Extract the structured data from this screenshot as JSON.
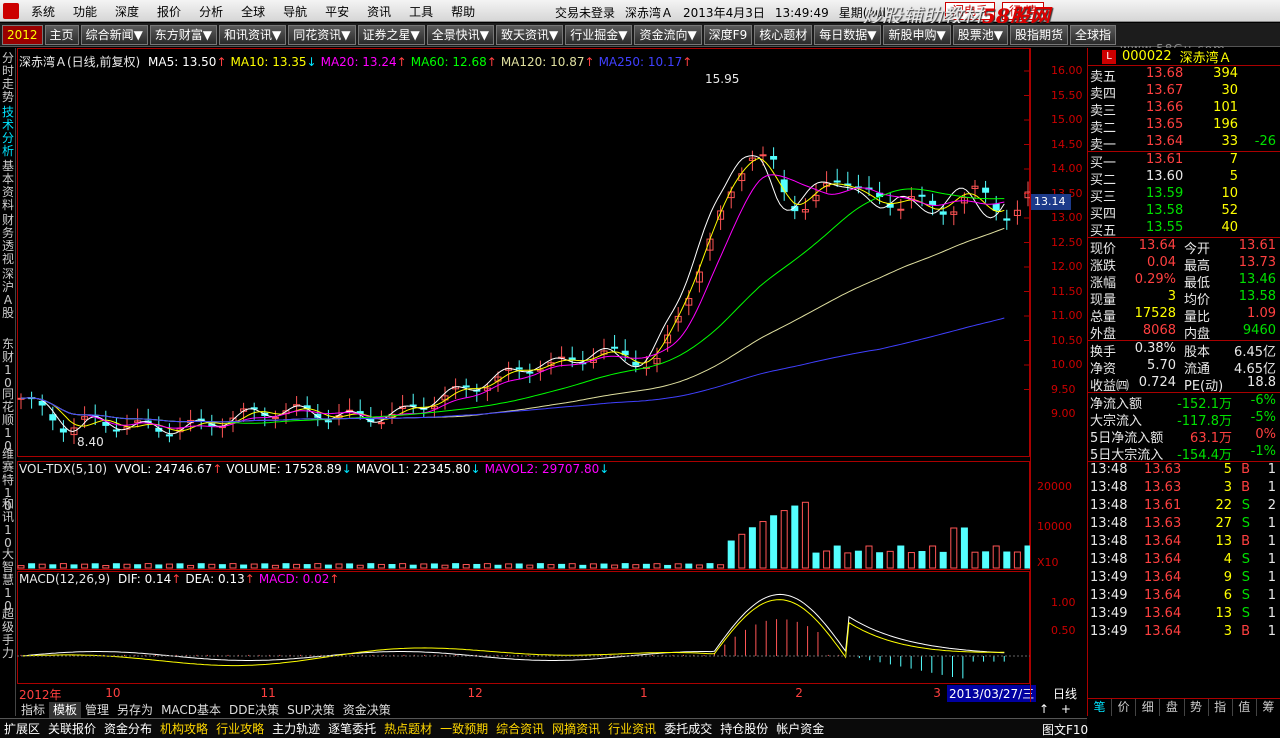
{
  "menubar": {
    "items": [
      "系统",
      "功能",
      "深度",
      "报价",
      "分析",
      "全球",
      "导航",
      "平安",
      "资讯",
      "工具",
      "帮助"
    ],
    "status": [
      "交易未登录",
      "深赤湾Ａ",
      "2013年4月3日",
      "13:49:49",
      "星期(null)"
    ],
    "btn_flash": "闪电手",
    "btn_quote": "行 情",
    "brand_a": "炒股辅助教材",
    "brand_b": "58股网"
  },
  "toolbar": {
    "logo": "2012",
    "items": [
      "主页",
      "综合新闻▼",
      "东方财富▼",
      "和讯资讯▼",
      "同花资讯▼",
      "证券之星▼",
      "全景快讯▼",
      "致天资讯▼",
      "行业掘金▼",
      "资金流向▼",
      "深度F9",
      "核心题材",
      "每日数据▼",
      "新股申购▼",
      "股票池▼",
      "股指期货",
      "全球指"
    ],
    "watermark": "www.58Gu.com"
  },
  "left_tabs": [
    "分时走势",
    "技术分析",
    "基本资料",
    "财务透视",
    "深沪A股",
    "东财10",
    "同花顺10",
    "维赛特10",
    "和讯10",
    "大智慧10",
    "超级手力"
  ],
  "main": {
    "stock_title": "深赤湾Ａ(日线,前复权)",
    "ma": [
      {
        "label": "MA5: 13.50",
        "arrow": "↑",
        "color": "#ffffff"
      },
      {
        "label": "MA10: 13.35",
        "arrow": "↓",
        "color": "#ffff00"
      },
      {
        "label": "MA20: 13.24",
        "arrow": "↑",
        "color": "#ff00ff"
      },
      {
        "label": "MA60: 12.68",
        "arrow": "↑",
        "color": "#00ff00"
      },
      {
        "label": "MA120: 10.87",
        "arrow": "↑",
        "color": "#e0e0a0"
      },
      {
        "label": "MA250: 10.17",
        "arrow": "↑",
        "color": "#4040ff"
      }
    ],
    "high_label": "15.95",
    "low_label": "8.40",
    "vol": {
      "title": "VOL-TDX(5,10)",
      "items": [
        {
          "label": "VVOL: 24746.67",
          "arrow": "↑",
          "color": "#ffffff"
        },
        {
          "label": "VOLUME: 17528.89",
          "arrow": "↓",
          "color": "#ffffff"
        },
        {
          "label": "MAVOL1: 22345.80",
          "arrow": "↓",
          "color": "#ffffff"
        },
        {
          "label": "MAVOL2: 29707.80",
          "arrow": "↓",
          "color": "#ff00ff"
        }
      ]
    },
    "macd": {
      "title": "MACD(12,26,9)",
      "items": [
        {
          "label": "DIF: 0.14",
          "arrow": "↑",
          "color": "#ffffff"
        },
        {
          "label": "DEA: 0.13",
          "arrow": "↑",
          "color": "#ffffff"
        },
        {
          "label": "MACD: 0.02",
          "arrow": "↑",
          "color": "#ff00ff"
        }
      ]
    },
    "date_box": "2013/03/27/三",
    "x_ticks": [
      {
        "t": "2012年",
        "i": 0
      },
      {
        "t": "10",
        "i": 25
      },
      {
        "t": "11",
        "i": 70
      },
      {
        "t": "12",
        "i": 130
      },
      {
        "t": "1",
        "i": 180
      },
      {
        "t": "2",
        "i": 225
      },
      {
        "t": "3",
        "i": 265
      }
    ]
  },
  "axis": {
    "price_ticks": [
      "16.00",
      "15.50",
      "15.00",
      "14.50",
      "14.00",
      "13.50",
      "13.00",
      "12.50",
      "12.00",
      "11.50",
      "11.00",
      "10.50",
      "10.00",
      "9.50",
      "9.00"
    ],
    "current_price": "13.14",
    "vol_ticks": [
      "20000",
      "10000"
    ],
    "vol_unit": "X10",
    "macd_ticks": [
      "1.00",
      "0.50"
    ]
  },
  "panel": {
    "license": "L",
    "code": "000022",
    "name": "深赤湾Ａ",
    "sell": [
      {
        "l": "卖五",
        "p": "13.68",
        "v": "394",
        "d": ""
      },
      {
        "l": "卖四",
        "p": "13.67",
        "v": "30",
        "d": ""
      },
      {
        "l": "卖三",
        "p": "13.66",
        "v": "101",
        "d": ""
      },
      {
        "l": "卖二",
        "p": "13.65",
        "v": "196",
        "d": ""
      },
      {
        "l": "卖一",
        "p": "13.64",
        "v": "33",
        "d": "-26"
      }
    ],
    "buy": [
      {
        "l": "买一",
        "p": "13.61",
        "v": "7",
        "c": "red"
      },
      {
        "l": "买二",
        "p": "13.60",
        "v": "5",
        "c": "white"
      },
      {
        "l": "买三",
        "p": "13.59",
        "v": "10",
        "c": "green"
      },
      {
        "l": "买四",
        "p": "13.58",
        "v": "52",
        "c": "green"
      },
      {
        "l": "买五",
        "p": "13.55",
        "v": "40",
        "c": "green"
      }
    ],
    "stats": [
      {
        "l1": "现价",
        "v1": "13.64",
        "c1": "red",
        "l2": "今开",
        "v2": "13.61",
        "c2": "red"
      },
      {
        "l1": "涨跌",
        "v1": "0.04",
        "c1": "red",
        "l2": "最高",
        "v2": "13.73",
        "c2": "red"
      },
      {
        "l1": "涨幅",
        "v1": "0.29%",
        "c1": "red",
        "l2": "最低",
        "v2": "13.46",
        "c2": "green"
      },
      {
        "l1": "现量",
        "v1": "3",
        "c1": "yellow",
        "l2": "均价",
        "v2": "13.58",
        "c2": "green"
      },
      {
        "l1": "总量",
        "v1": "17528",
        "c1": "yellow",
        "l2": "量比",
        "v2": "1.09",
        "c2": "red"
      },
      {
        "l1": "外盘",
        "v1": "8068",
        "c1": "red",
        "l2": "内盘",
        "v2": "9460",
        "c2": "green"
      }
    ],
    "stats2": [
      {
        "l1": "换手",
        "v1": "0.38%",
        "c1": "white",
        "l2": "股本",
        "v2": "6.45亿",
        "c2": "white"
      },
      {
        "l1": "净资",
        "v1": "5.70",
        "c1": "white",
        "l2": "流通",
        "v2": "4.65亿",
        "c2": "white"
      },
      {
        "l1": "收益㈣",
        "v1": "0.724",
        "c1": "white",
        "l2": "PE(动)",
        "v2": "18.8",
        "c2": "white"
      }
    ],
    "flows": [
      {
        "l": "净流入额",
        "v": "-152.1万",
        "p": "-6%",
        "c": "green"
      },
      {
        "l": "大宗流入",
        "v": "-117.8万",
        "p": "-5%",
        "c": "green"
      },
      {
        "l": "5日净流入额",
        "v": "63.1万",
        "p": "0%",
        "c": "red"
      },
      {
        "l": "5日大宗流入",
        "v": "-154.4万",
        "p": "-1%",
        "c": "green"
      }
    ],
    "ticks": [
      {
        "t": "13:48",
        "p": "13.63",
        "v": "5",
        "s": "B",
        "n": "1"
      },
      {
        "t": "13:48",
        "p": "13.63",
        "v": "3",
        "s": "B",
        "n": "1"
      },
      {
        "t": "13:48",
        "p": "13.61",
        "v": "22",
        "s": "S",
        "n": "2"
      },
      {
        "t": "13:48",
        "p": "13.63",
        "v": "27",
        "s": "S",
        "n": "1"
      },
      {
        "t": "13:48",
        "p": "13.64",
        "v": "13",
        "s": "B",
        "n": "1"
      },
      {
        "t": "13:48",
        "p": "13.64",
        "v": "4",
        "s": "S",
        "n": "1"
      },
      {
        "t": "13:49",
        "p": "13.64",
        "v": "9",
        "s": "S",
        "n": "1"
      },
      {
        "t": "13:49",
        "p": "13.64",
        "v": "6",
        "s": "S",
        "n": "1"
      },
      {
        "t": "13:49",
        "p": "13.64",
        "v": "13",
        "s": "S",
        "n": "1"
      },
      {
        "t": "13:49",
        "p": "13.64",
        "v": "3",
        "s": "B",
        "n": "1"
      }
    ],
    "tabs": [
      "笔",
      "价",
      "细",
      "盘",
      "势",
      "指",
      "值",
      "筹"
    ]
  },
  "bottom": {
    "period": "日线",
    "ctrl": "↑ + - ↓",
    "tabs1": [
      "指标",
      "模板",
      "管理",
      "另存为",
      "MACD基本",
      "DDE决策",
      "SUP决策",
      "资金决策"
    ],
    "tabs2": [
      {
        "t": "扩展区",
        "hl": false
      },
      {
        "t": "关联报价",
        "hl": false
      },
      {
        "t": "资金分布",
        "hl": false
      },
      {
        "t": "机构攻略",
        "hl": true
      },
      {
        "t": "行业攻略",
        "hl": true
      },
      {
        "t": "主力轨迹",
        "hl": false
      },
      {
        "t": "逐笔委托",
        "hl": false
      },
      {
        "t": "热点题材",
        "hl": true
      },
      {
        "t": "一致预期",
        "hl": true
      },
      {
        "t": "综合资讯",
        "hl": true
      },
      {
        "t": "网摘资讯",
        "hl": true
      },
      {
        "t": "行业资讯",
        "hl": true
      },
      {
        "t": "委托成交",
        "hl": false
      },
      {
        "t": "持仓股份",
        "hl": false
      },
      {
        "t": "帐户资金",
        "hl": false
      }
    ],
    "f10": "图文F10"
  },
  "colors": {
    "up": "#ff5555",
    "down": "#54ffff",
    "ma5": "#ffffff",
    "ma10": "#ffff00",
    "ma20": "#ff00ff",
    "ma60": "#00ff00",
    "ma120": "#e0e0a0",
    "ma250": "#4040ff"
  }
}
